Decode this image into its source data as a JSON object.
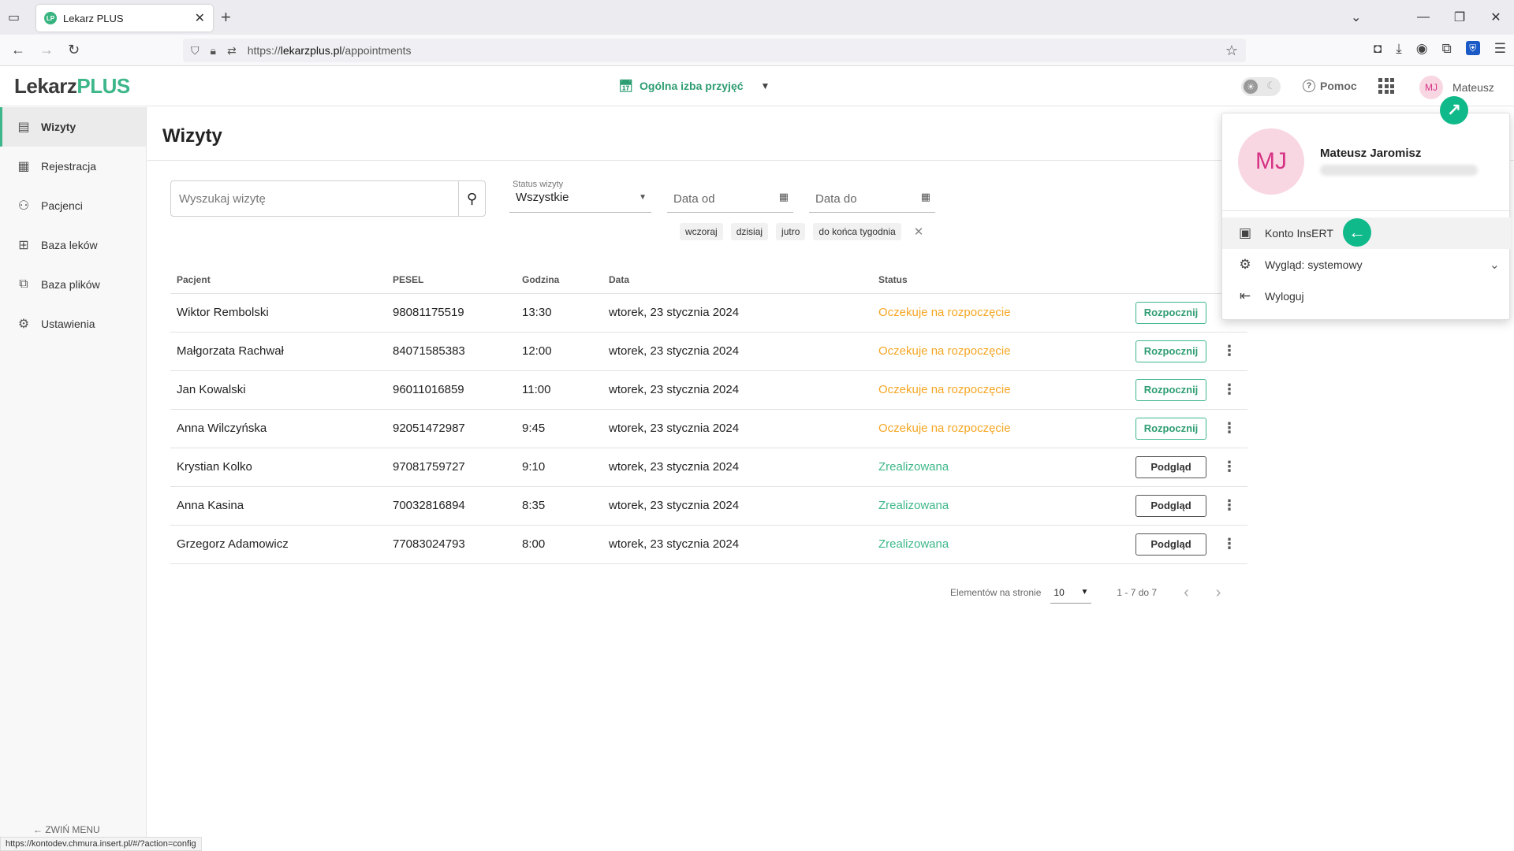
{
  "browser": {
    "tab_title": "Lekarz PLUS",
    "tab_favicon": "LP",
    "url_prefix": "https://",
    "url_host": "lekarzplus.pl",
    "url_path": "/appointments",
    "status_bar_link": "https://kontodev.chmura.insert.pl/#/?action=config"
  },
  "header": {
    "logo_main": "Lekarz",
    "logo_accent": "PLUS",
    "clinic_name": "Ogólna izba przyjęć",
    "help_label": "Pomoc",
    "user_initials": "MJ",
    "user_short_name": "Mateusz"
  },
  "sidebar": {
    "items": [
      {
        "label": "Wizyty",
        "icon": "visits-icon"
      },
      {
        "label": "Rejestracja",
        "icon": "calendar-icon"
      },
      {
        "label": "Pacjenci",
        "icon": "patients-icon"
      },
      {
        "label": "Baza leków",
        "icon": "medicine-icon"
      },
      {
        "label": "Baza plików",
        "icon": "files-icon"
      },
      {
        "label": "Ustawienia",
        "icon": "gear-icon"
      }
    ],
    "collapse_label": "ZWIŃ MENU"
  },
  "main": {
    "title": "Wizyty",
    "search_placeholder": "Wyszukaj wizytę",
    "status_filter_label": "Status wizyty",
    "status_filter_value": "Wszystkie",
    "date_from_placeholder": "Data od",
    "date_to_placeholder": "Data do",
    "quick_dates": [
      "wczoraj",
      "dzisiaj",
      "jutro",
      "do końca tygodnia"
    ]
  },
  "table": {
    "columns": [
      "Pacjent",
      "PESEL",
      "Godzina",
      "Data",
      "Status"
    ],
    "rows": [
      {
        "patient": "Wiktor Rembolski",
        "pesel": "98081175519",
        "time": "13:30",
        "date": "wtorek, 23 stycznia 2024",
        "status": "Oczekuje na rozpoczęcie",
        "action": "Rozpocznij"
      },
      {
        "patient": "Małgorzata Rachwał",
        "pesel": "84071585383",
        "time": "12:00",
        "date": "wtorek, 23 stycznia 2024",
        "status": "Oczekuje na rozpoczęcie",
        "action": "Rozpocznij"
      },
      {
        "patient": "Jan Kowalski",
        "pesel": "96011016859",
        "time": "11:00",
        "date": "wtorek, 23 stycznia 2024",
        "status": "Oczekuje na rozpoczęcie",
        "action": "Rozpocznij"
      },
      {
        "patient": "Anna Wilczyńska",
        "pesel": "92051472987",
        "time": "9:45",
        "date": "wtorek, 23 stycznia 2024",
        "status": "Oczekuje na rozpoczęcie",
        "action": "Rozpocznij"
      },
      {
        "patient": "Krystian Kolko",
        "pesel": "97081759727",
        "time": "9:10",
        "date": "wtorek, 23 stycznia 2024",
        "status": "Zrealizowana",
        "action": "Podgląd"
      },
      {
        "patient": "Anna Kasina",
        "pesel": "70032816894",
        "time": "8:35",
        "date": "wtorek, 23 stycznia 2024",
        "status": "Zrealizowana",
        "action": "Podgląd"
      },
      {
        "patient": "Grzegorz Adamowicz",
        "pesel": "77083024793",
        "time": "8:00",
        "date": "wtorek, 23 stycznia 2024",
        "status": "Zrealizowana",
        "action": "Podgląd"
      }
    ]
  },
  "pagination": {
    "per_page_label": "Elementów na stronie",
    "per_page_value": "10",
    "range": "1 - 7 do 7"
  },
  "user_menu": {
    "initials": "MJ",
    "full_name": "Mateusz Jaromisz",
    "items": [
      {
        "label": "Konto InsERT",
        "icon": "account-icon"
      },
      {
        "label": "Wygląd: systemowy",
        "icon": "appearance-icon"
      },
      {
        "label": "Wyloguj",
        "icon": "logout-icon"
      }
    ]
  },
  "colors": {
    "accent": "#3DB78A",
    "waiting": "#F5A623",
    "done": "#3DB78A",
    "avatar_bg": "#F8D7E3",
    "avatar_fg": "#D63384",
    "annotation_arrow": "#10B98A"
  }
}
